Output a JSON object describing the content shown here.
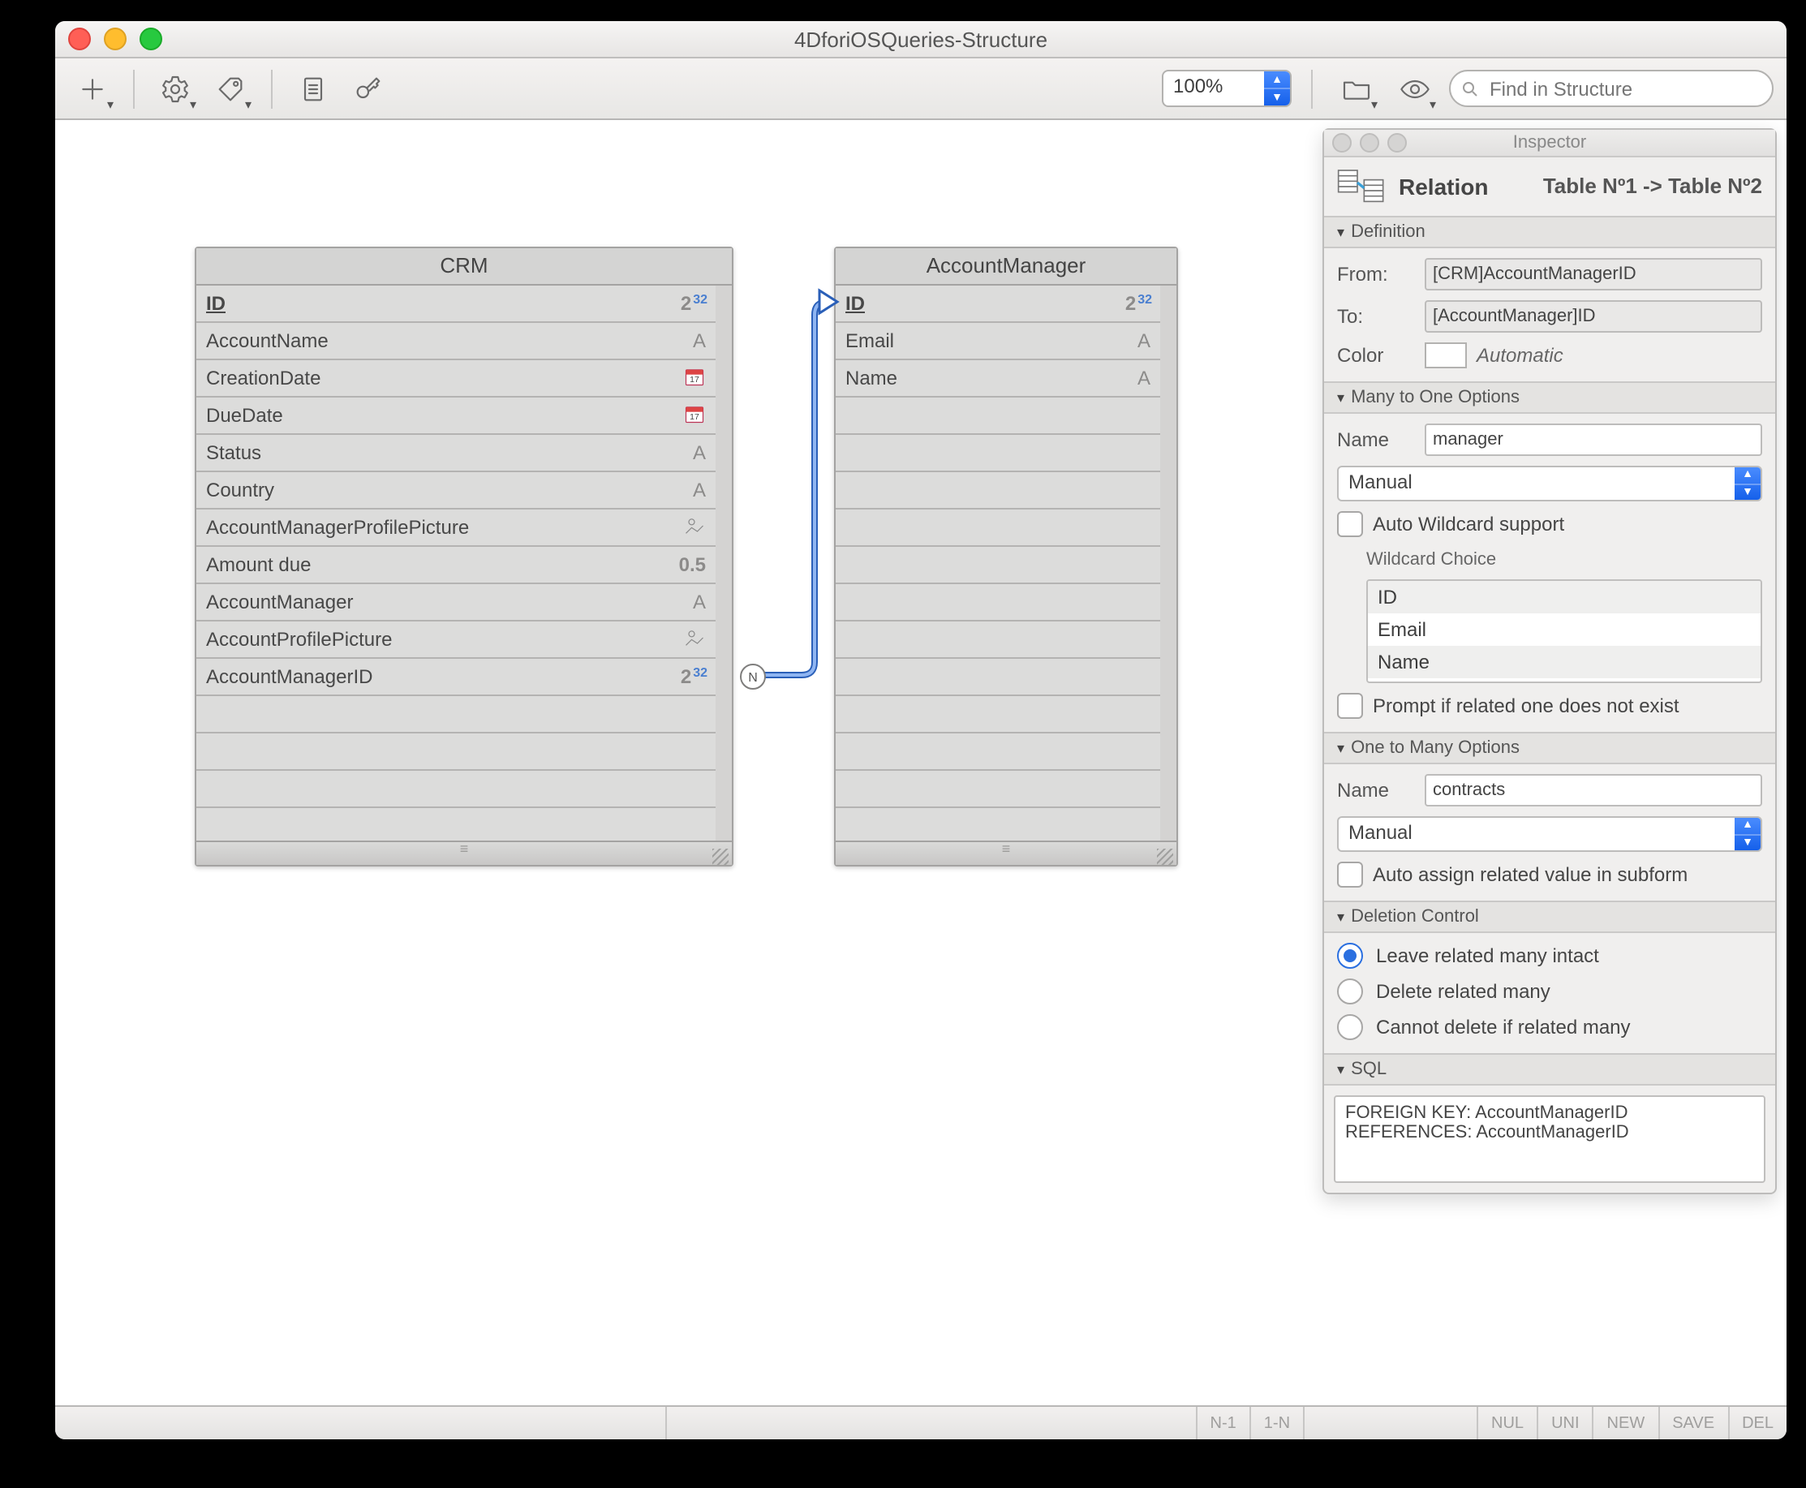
{
  "window": {
    "title": "4DforiOSQueries-Structure"
  },
  "toolbar": {
    "zoom": "100%",
    "search_placeholder": "Find in Structure"
  },
  "tables": {
    "crm": {
      "title": "CRM",
      "fields": [
        {
          "name": "ID",
          "type": "longint",
          "pk": true
        },
        {
          "name": "AccountName",
          "type": "alpha"
        },
        {
          "name": "CreationDate",
          "type": "date"
        },
        {
          "name": "DueDate",
          "type": "date"
        },
        {
          "name": "Status",
          "type": "alpha"
        },
        {
          "name": "Country",
          "type": "alpha"
        },
        {
          "name": "AccountManagerProfilePicture",
          "type": "picture"
        },
        {
          "name": "Amount due",
          "type": "real"
        },
        {
          "name": "AccountManager",
          "type": "alpha"
        },
        {
          "name": "AccountProfilePicture",
          "type": "picture"
        },
        {
          "name": "AccountManagerID",
          "type": "longint"
        }
      ]
    },
    "am": {
      "title": "AccountManager",
      "fields": [
        {
          "name": "ID",
          "type": "longint",
          "pk": true
        },
        {
          "name": "Email",
          "type": "alpha"
        },
        {
          "name": "Name",
          "type": "alpha"
        }
      ]
    }
  },
  "inspector": {
    "panel_title": "Inspector",
    "header_label": "Relation",
    "header_sub": "Table Nº1 -> Table Nº2",
    "definition": {
      "title": "Definition",
      "from_label": "From:",
      "from_value": "[CRM]AccountManagerID",
      "to_label": "To:",
      "to_value": "[AccountManager]ID",
      "color_label": "Color",
      "color_value": "Automatic"
    },
    "manyToOne": {
      "title": "Many to One Options",
      "name_label": "Name",
      "name_value": "manager",
      "mode": "Manual",
      "auto_wildcard": "Auto Wildcard support",
      "wildcard_label": "Wildcard Choice",
      "wildcard_list": [
        "ID",
        "Email",
        "Name"
      ],
      "prompt": "Prompt if related one does not exist"
    },
    "oneToMany": {
      "title": "One to Many Options",
      "name_label": "Name",
      "name_value": "contracts",
      "mode": "Manual",
      "auto_assign": "Auto assign related value in subform"
    },
    "deletion": {
      "title": "Deletion Control",
      "options": [
        "Leave related many intact",
        "Delete related many",
        "Cannot delete if related many"
      ],
      "selected": 0
    },
    "sql": {
      "title": "SQL",
      "text": "FOREIGN KEY: AccountManagerID\nREFERENCES: AccountManagerID"
    }
  },
  "statusbar": {
    "n1": "N-1",
    "n2": "1-N",
    "nul": "NUL",
    "uni": "UNI",
    "new": "NEW",
    "save": "SAVE",
    "del": "DEL"
  }
}
